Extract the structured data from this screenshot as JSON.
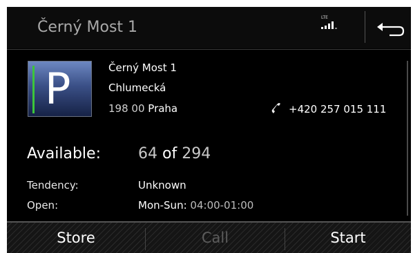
{
  "header": {
    "title": "Černý Most 1",
    "signal_label": "LTE",
    "back_icon": "back-arrow-icon"
  },
  "logo": {
    "letter": "P",
    "stripe_color": "#3cc63a"
  },
  "address": {
    "name": "Černý Most 1",
    "street": "Chlumecká",
    "zip": "198 00",
    "city": "Praha"
  },
  "phone": {
    "icon": "phone-icon",
    "number": "+420 257 015 111"
  },
  "availability": {
    "label": "Available:",
    "current": "64",
    "of": "of",
    "total": "294"
  },
  "info": {
    "tendency_label": "Tendency:",
    "tendency_value": "Unknown",
    "open_label": "Open:",
    "open_days": "Mon-Sun:",
    "open_hours": "04:00-01:00"
  },
  "footer": {
    "store": "Store",
    "call": "Call",
    "start": "Start"
  }
}
